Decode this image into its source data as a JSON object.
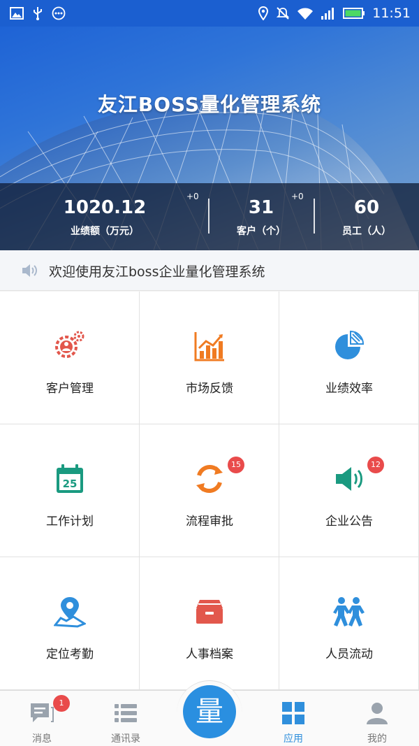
{
  "status_bar": {
    "time": "11:51",
    "left_icons": [
      "image-icon",
      "usb-icon",
      "more-dots-icon"
    ],
    "right_icons": [
      "location-icon",
      "mute-icon",
      "wifi-icon",
      "signal-icon",
      "battery-icon"
    ]
  },
  "banner": {
    "title": "友江BOSS量化管理系统",
    "stats": [
      {
        "value": "1020.12",
        "label": "业绩额（万元）",
        "delta": "+0"
      },
      {
        "value": "31",
        "label": "客户（个）",
        "delta": "+0"
      },
      {
        "value": "60",
        "label": "员工（人）",
        "delta": ""
      }
    ]
  },
  "notice": {
    "text": "欢迎使用友江boss企业量化管理系统",
    "icon": "speaker-icon"
  },
  "grid": {
    "items": [
      {
        "label": "客户管理",
        "icon": "customer-gear-icon",
        "badge": ""
      },
      {
        "label": "市场反馈",
        "icon": "bar-chart-icon",
        "badge": ""
      },
      {
        "label": "业绩效率",
        "icon": "pie-chart-icon",
        "badge": ""
      },
      {
        "label": "工作计划",
        "icon": "calendar-icon",
        "calendar_day": "25",
        "badge": ""
      },
      {
        "label": "流程审批",
        "icon": "refresh-cycle-icon",
        "badge": "15"
      },
      {
        "label": "企业公告",
        "icon": "megaphone-icon",
        "badge": "12"
      },
      {
        "label": "定位考勤",
        "icon": "location-pin-icon",
        "badge": ""
      },
      {
        "label": "人事档案",
        "icon": "archive-box-icon",
        "badge": ""
      },
      {
        "label": "人员流动",
        "icon": "people-walking-icon",
        "badge": ""
      }
    ]
  },
  "tab_bar": {
    "items": [
      {
        "label": "消息",
        "icon": "message-icon",
        "badge": "1",
        "active": false
      },
      {
        "label": "通讯录",
        "icon": "list-icon",
        "badge": "",
        "active": false
      },
      {
        "label": "应用",
        "icon": "apps-icon",
        "badge": "",
        "active": true
      },
      {
        "label": "我的",
        "icon": "user-icon",
        "badge": "",
        "active": false
      }
    ],
    "center_button": "量"
  },
  "colors": {
    "status_bar": "#1b5fd0",
    "accent": "#2a8fe0",
    "badge": "#e94b4b",
    "customer": "#e2574c",
    "market": "#f07b22",
    "performance": "#2f8fdc",
    "plan": "#1a9a80",
    "approval": "#f07b22",
    "announcement": "#1a9a80",
    "attendance": "#2f8fdc",
    "archive": "#e2574c",
    "flow": "#2f8fdc"
  }
}
